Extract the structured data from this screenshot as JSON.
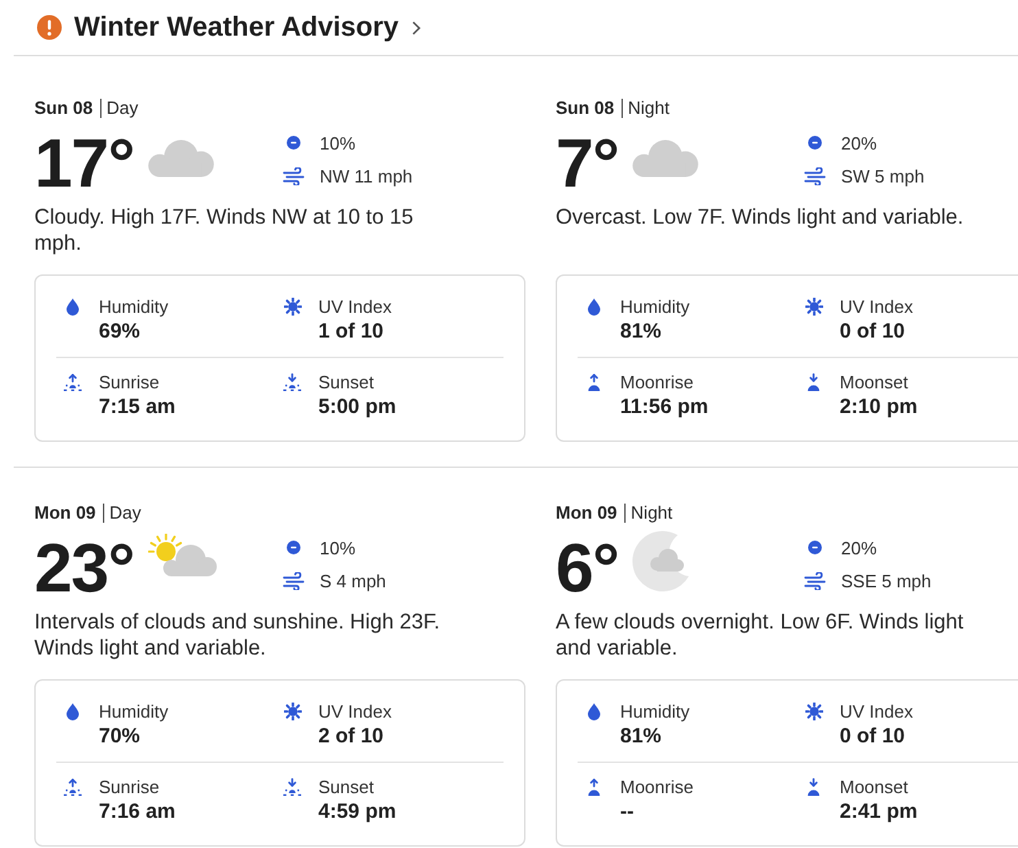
{
  "advisory": {
    "title": "Winter Weather Advisory"
  },
  "days": [
    {
      "periods": [
        {
          "kind": "cloudy",
          "day": "Sun 08",
          "period": "Day",
          "temperature": "17°",
          "precipitation": "10%",
          "wind": "NW 11 mph",
          "summary": "Cloudy. High 17F. Winds NW at 10 to 15 mph.",
          "details": [
            {
              "kind": "humidity",
              "label": "Humidity",
              "value": "69%"
            },
            {
              "kind": "uv",
              "label": "UV Index",
              "value": "1 of 10"
            },
            {
              "kind": "sunrise",
              "label": "Sunrise",
              "value": "7:15 am"
            },
            {
              "kind": "sunset",
              "label": "Sunset",
              "value": "5:00 pm"
            }
          ]
        },
        {
          "kind": "cloudy",
          "day": "Sun 08",
          "period": "Night",
          "temperature": "7°",
          "precipitation": "20%",
          "wind": "SW 5 mph",
          "summary": "Overcast. Low 7F. Winds light and variable.",
          "details": [
            {
              "kind": "humidity",
              "label": "Humidity",
              "value": "81%"
            },
            {
              "kind": "uv",
              "label": "UV Index",
              "value": "0 of 10"
            },
            {
              "kind": "moonrise",
              "label": "Moonrise",
              "value": "11:56 pm"
            },
            {
              "kind": "moonset",
              "label": "Moonset",
              "value": "2:10 pm"
            }
          ]
        }
      ]
    },
    {
      "periods": [
        {
          "kind": "partly-sunny",
          "day": "Mon 09",
          "period": "Day",
          "temperature": "23°",
          "precipitation": "10%",
          "wind": "S 4 mph",
          "summary": "Intervals of clouds and sunshine. High 23F. Winds light and variable.",
          "details": [
            {
              "kind": "humidity",
              "label": "Humidity",
              "value": "70%"
            },
            {
              "kind": "uv",
              "label": "UV Index",
              "value": "2 of 10"
            },
            {
              "kind": "sunrise",
              "label": "Sunrise",
              "value": "7:16 am"
            },
            {
              "kind": "sunset",
              "label": "Sunset",
              "value": "4:59 pm"
            }
          ]
        },
        {
          "kind": "night-partly-cloudy",
          "day": "Mon 09",
          "period": "Night",
          "temperature": "6°",
          "precipitation": "20%",
          "wind": "SSE 5 mph",
          "summary": "A few clouds overnight. Low 6F. Winds light and variable.",
          "details": [
            {
              "kind": "humidity",
              "label": "Humidity",
              "value": "81%"
            },
            {
              "kind": "uv",
              "label": "UV Index",
              "value": "0 of 10"
            },
            {
              "kind": "moonrise",
              "label": "Moonrise",
              "value": "--"
            },
            {
              "kind": "moonset",
              "label": "Moonset",
              "value": "2:41 pm"
            }
          ]
        }
      ]
    }
  ]
}
